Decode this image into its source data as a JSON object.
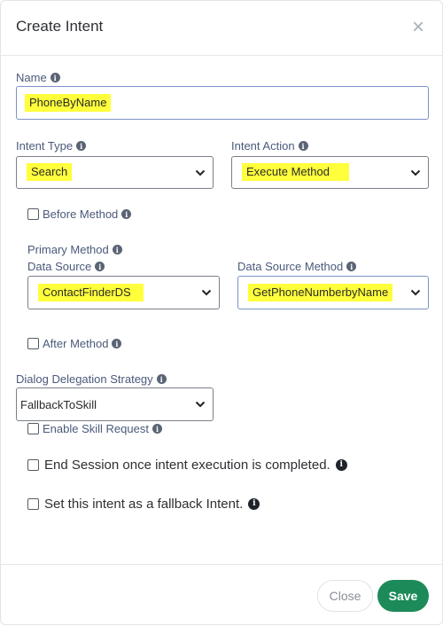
{
  "dialog": {
    "title": "Create Intent",
    "close_icon": "×"
  },
  "name": {
    "label": "Name",
    "value": "PhoneByName"
  },
  "intent_type": {
    "label": "Intent Type",
    "value": "Search"
  },
  "intent_action": {
    "label": "Intent Action",
    "value": "Execute Method"
  },
  "before_method": {
    "label": "Before Method",
    "checked": false
  },
  "primary_method": {
    "label": "Primary Method",
    "data_source": {
      "label": "Data Source",
      "value": "ContactFinderDS"
    },
    "data_source_method": {
      "label": "Data Source Method",
      "value": "GetPhoneNumberbyName"
    }
  },
  "after_method": {
    "label": "After Method",
    "checked": false
  },
  "dialog_delegation": {
    "label": "Dialog Delegation Strategy",
    "value": "FallbackToSkill"
  },
  "enable_skill_request": {
    "label": "Enable Skill Request",
    "checked": false
  },
  "end_session": {
    "label": "End Session once intent execution is completed.",
    "checked": false
  },
  "fallback_intent": {
    "label": "Set this intent as a fallback Intent.",
    "checked": false
  },
  "footer": {
    "close_label": "Close",
    "save_label": "Save"
  },
  "icons": {
    "info": "info-circle-icon",
    "dropdown": "chevron-down-icon",
    "close": "close-icon"
  },
  "colors": {
    "highlight": "#ffff3c",
    "save_button": "#1d8a5a",
    "label": "#4a5a7a",
    "field_focus_border": "#7b93c9"
  }
}
